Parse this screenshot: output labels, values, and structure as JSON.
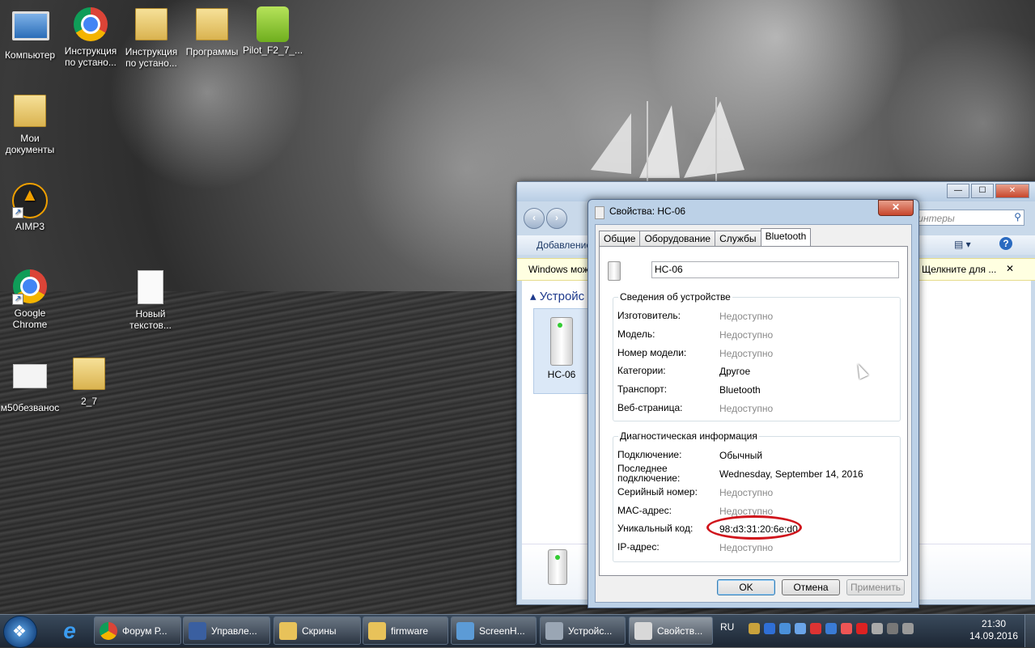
{
  "desktop": {
    "icons": [
      {
        "label": "Компьютер"
      },
      {
        "label": "Инструкция по устано..."
      },
      {
        "label": "Инструкция по устано..."
      },
      {
        "label": "Программы"
      },
      {
        "label": "Pilot_F2_7_..."
      },
      {
        "label": "Мои документы"
      },
      {
        "label": "AIMP3"
      },
      {
        "label": "Google Chrome"
      },
      {
        "label": "Новый текстов..."
      },
      {
        "label": "м50безванос"
      },
      {
        "label": "2_7"
      }
    ]
  },
  "explorer": {
    "search_placeholder": "и принтеры",
    "command": "Добавление",
    "info_left": "Windows мож",
    "info_right": "Щелкните для ...",
    "info_close": "✕",
    "group": "Устройс",
    "device_label": "HC-06",
    "window_buttons": [
      "—",
      "☐",
      "✕"
    ]
  },
  "dialog": {
    "title": "Свойства: HC-06",
    "close": "✕",
    "tabs": [
      "Общие",
      "Оборудование",
      "Службы",
      "Bluetooth"
    ],
    "active_tab": "Bluetooth",
    "device_name": "HC-06",
    "info_group": {
      "title": "Сведения об устройстве",
      "rows": [
        {
          "label": "Изготовитель:",
          "value": "Недоступно",
          "muted": true
        },
        {
          "label": "Модель:",
          "value": "Недоступно",
          "muted": true
        },
        {
          "label": "Номер модели:",
          "value": "Недоступно",
          "muted": true
        },
        {
          "label": "Категории:",
          "value": "Другое",
          "muted": false
        },
        {
          "label": "Транспорт:",
          "value": "Bluetooth",
          "muted": false
        },
        {
          "label": "Веб-страница:",
          "value": "Недоступно",
          "muted": true
        }
      ]
    },
    "diag_group": {
      "title": "Диагностическая информация",
      "rows": [
        {
          "label": "Подключение:",
          "value": "Обычный",
          "muted": false
        },
        {
          "label": "Последнее подключение:",
          "value": "Wednesday, September 14, 2016",
          "muted": false
        },
        {
          "label": "Серийный номер:",
          "value": "Недоступно",
          "muted": true
        },
        {
          "label": "MAC-адрес:",
          "value": "Недоступно",
          "muted": true
        },
        {
          "label": "Уникальный код:",
          "value": "98:d3:31:20:6e:d0",
          "muted": false
        },
        {
          "label": "IP-адрес:",
          "value": "Недоступно",
          "muted": true
        }
      ]
    },
    "buttons": {
      "ok": "OK",
      "cancel": "Отмена",
      "apply": "Применить"
    }
  },
  "taskbar": {
    "items": [
      {
        "label": "Форум Р...",
        "color": "#db4437"
      },
      {
        "label": "Управле...",
        "color": "#3a5fa0"
      },
      {
        "label": "Скрины",
        "color": "#e8c25a"
      },
      {
        "label": "firmware",
        "color": "#e8c25a"
      },
      {
        "label": "ScreenH...",
        "color": "#5c9bd6"
      },
      {
        "label": "Устройс...",
        "color": "#9aa6b4"
      },
      {
        "label": "Свойств...",
        "color": "#d8d8d8"
      }
    ],
    "language": "RU",
    "time": "21:30",
    "date": "14.09.2016"
  }
}
